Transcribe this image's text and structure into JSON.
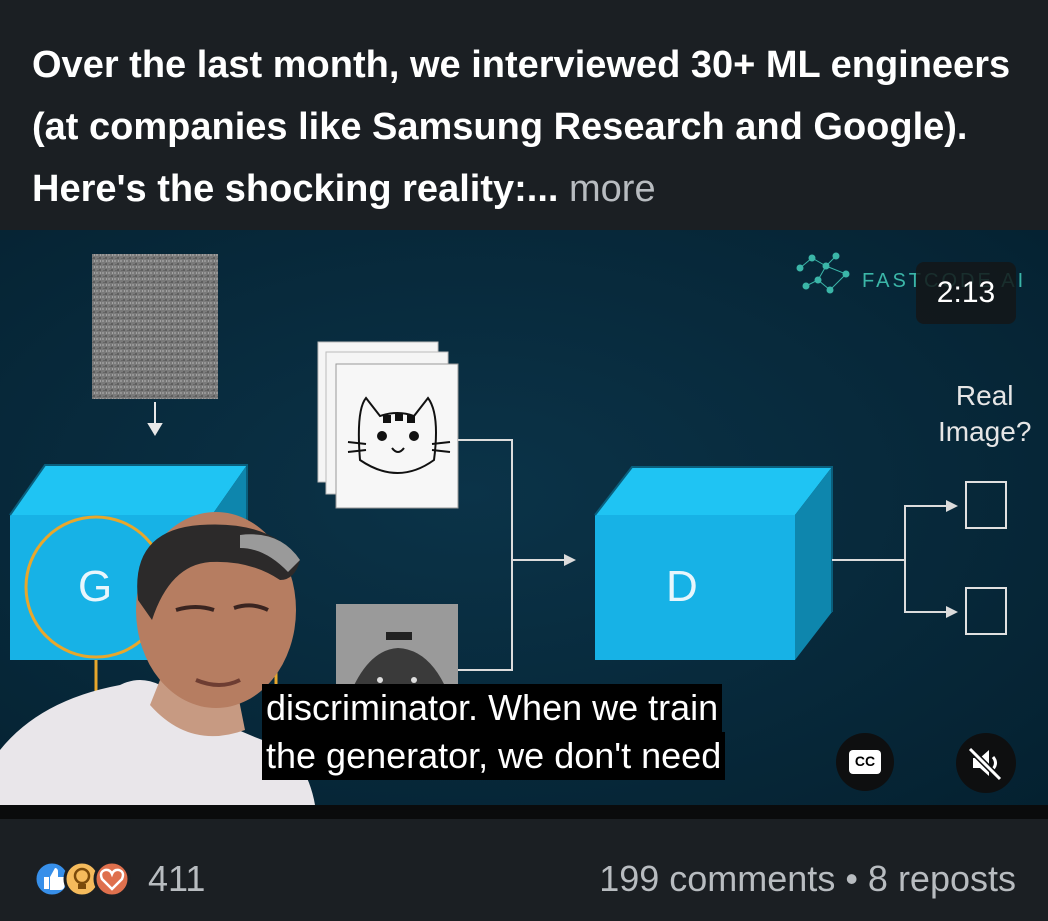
{
  "post": {
    "text": "Over the last month, we interviewed 30+ ML engineers (at companies like Samsung Research and Google). Here's the shocking reality:...",
    "more_label": "more"
  },
  "video": {
    "timestamp": "2:13",
    "caption_line1": "discriminator. When we train",
    "caption_line2": "the generator, we don't need",
    "cc_label": "CC",
    "slide": {
      "generator_label": "G",
      "discriminator_label": "D",
      "question_line1": "Real",
      "question_line2": "Image?",
      "watermark": "FASTCODE AI"
    }
  },
  "footer": {
    "reaction_count": "411",
    "comments": "199 comments",
    "separator": "•",
    "reposts": "8 reposts"
  },
  "colors": {
    "cube_front": "#17b2e6",
    "cube_top": "#1fc4f3",
    "cube_side": "#0e86ad",
    "slide_bg": "#062a3e",
    "like_blue": "#378fe9",
    "insight_yellow": "#f5bb5c",
    "love_red": "#df704d"
  }
}
